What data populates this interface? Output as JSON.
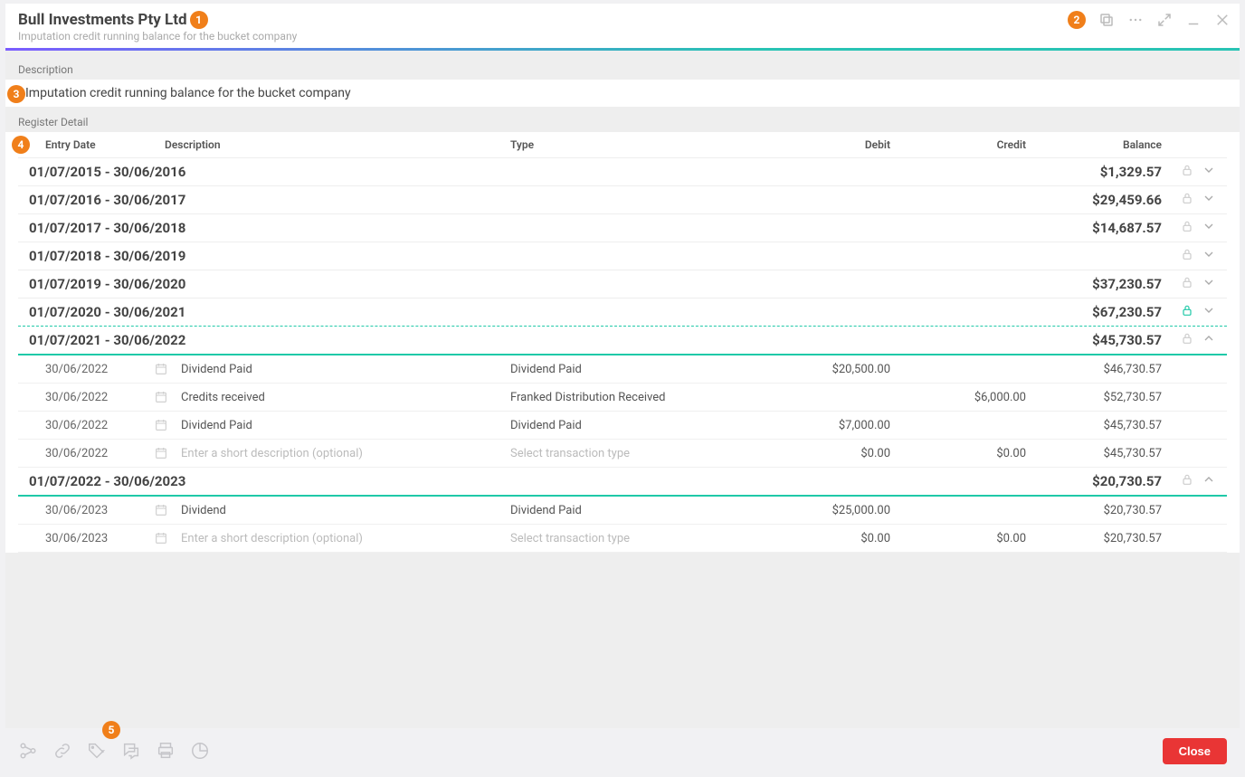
{
  "header": {
    "title": "Bull Investments Pty Ltd",
    "subtitle": "Imputation credit running balance for the bucket company"
  },
  "description": {
    "label": "Description",
    "value": "Imputation credit running balance for the bucket company"
  },
  "register": {
    "label": "Register Detail",
    "columns": {
      "entry_date": "Entry Date",
      "description": "Description",
      "type": "Type",
      "debit": "Debit",
      "credit": "Credit",
      "balance": "Balance"
    }
  },
  "periods": [
    {
      "range": "01/07/2015 - 30/06/2016",
      "balance": "$1,329.57",
      "expanded": false,
      "lockActive": false
    },
    {
      "range": "01/07/2016 - 30/06/2017",
      "balance": "$29,459.66",
      "expanded": false,
      "lockActive": false
    },
    {
      "range": "01/07/2017 - 30/06/2018",
      "balance": "$14,687.57",
      "expanded": false,
      "lockActive": false
    },
    {
      "range": "01/07/2018 - 30/06/2019",
      "balance": "",
      "expanded": false,
      "lockActive": false
    },
    {
      "range": "01/07/2019 - 30/06/2020",
      "balance": "$37,230.57",
      "expanded": false,
      "lockActive": false
    },
    {
      "range": "01/07/2020 - 30/06/2021",
      "balance": "$67,230.57",
      "expanded": false,
      "lockActive": true
    },
    {
      "range": "01/07/2021 - 30/06/2022",
      "balance": "$45,730.57",
      "expanded": true,
      "lockActive": false,
      "rows": [
        {
          "date": "30/06/2022",
          "desc": "Dividend Paid",
          "type": "Dividend Paid",
          "debit": "$20,500.00",
          "credit": "",
          "bal": "$46,730.57"
        },
        {
          "date": "30/06/2022",
          "desc": "Credits received",
          "type": "Franked Distribution Received",
          "debit": "",
          "credit": "$6,000.00",
          "bal": "$52,730.57"
        },
        {
          "date": "30/06/2022",
          "desc": "Dividend Paid",
          "type": "Dividend Paid",
          "debit": "$7,000.00",
          "credit": "",
          "bal": "$45,730.57"
        },
        {
          "date": "30/06/2022",
          "desc": "",
          "descPh": "Enter a short description (optional)",
          "type": "",
          "typePh": "Select transaction type",
          "debit": "$0.00",
          "credit": "$0.00",
          "bal": "$45,730.57"
        }
      ]
    },
    {
      "range": "01/07/2022 - 30/06/2023",
      "balance": "$20,730.57",
      "expanded": true,
      "lockActive": false,
      "rows": [
        {
          "date": "30/06/2023",
          "desc": "Dividend",
          "type": "Dividend Paid",
          "debit": "$25,000.00",
          "credit": "",
          "bal": "$20,730.57"
        },
        {
          "date": "30/06/2023",
          "desc": "",
          "descPh": "Enter a short description (optional)",
          "type": "",
          "typePh": "Select transaction type",
          "debit": "$0.00",
          "credit": "$0.00",
          "bal": "$20,730.57"
        }
      ]
    }
  ],
  "footer": {
    "close": "Close"
  },
  "badges": {
    "b1": "1",
    "b2": "2",
    "b3": "3",
    "b4": "4",
    "b5": "5"
  }
}
